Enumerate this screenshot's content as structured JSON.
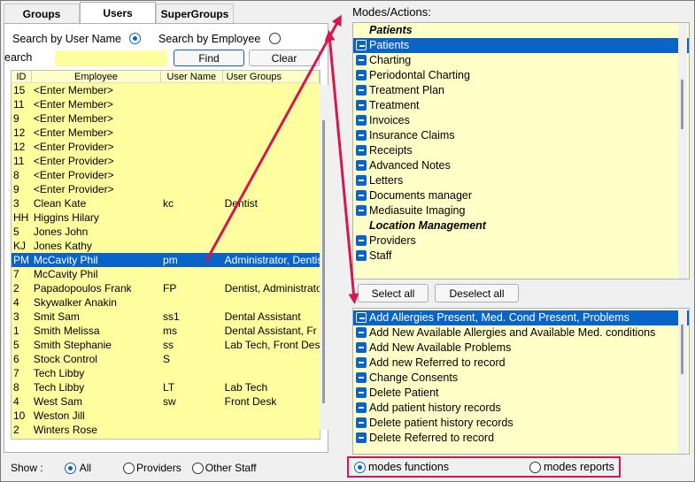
{
  "tabs": [
    "Groups",
    "Users",
    "SuperGroups"
  ],
  "search": {
    "by_user_name": "Search by User Name",
    "by_employee": "Search by Employee",
    "label": "earch",
    "value": "",
    "find": "Find",
    "clear": "Clear"
  },
  "grid": {
    "headers": [
      "ID",
      "Employee",
      "User Name",
      "User Groups"
    ],
    "rows": [
      {
        "id": "15",
        "employee": "<Enter Member>",
        "user": "",
        "groups": ""
      },
      {
        "id": "11",
        "employee": "<Enter Member>",
        "user": "",
        "groups": ""
      },
      {
        "id": "9",
        "employee": "<Enter Member>",
        "user": "",
        "groups": ""
      },
      {
        "id": "12",
        "employee": "<Enter Member>",
        "user": "",
        "groups": ""
      },
      {
        "id": "12",
        "employee": "<Enter Provider>",
        "user": "",
        "groups": ""
      },
      {
        "id": "11",
        "employee": "<Enter Provider>",
        "user": "",
        "groups": ""
      },
      {
        "id": "8",
        "employee": "<Enter Provider>",
        "user": "",
        "groups": ""
      },
      {
        "id": "9",
        "employee": "<Enter Provider>",
        "user": "",
        "groups": ""
      },
      {
        "id": "3",
        "employee": "Clean Kate",
        "user": "kc",
        "groups": "Dentist"
      },
      {
        "id": "HH",
        "employee": "Higgins Hilary",
        "user": "",
        "groups": ""
      },
      {
        "id": "5",
        "employee": "Jones John",
        "user": "",
        "groups": ""
      },
      {
        "id": "KJ",
        "employee": "Jones Kathy",
        "user": "",
        "groups": ""
      },
      {
        "id": "PM",
        "employee": "McCavity Phil",
        "user": "pm",
        "groups": "Administrator, Dentist"
      },
      {
        "id": "7",
        "employee": "McCavity Phil",
        "user": "",
        "groups": ""
      },
      {
        "id": "2",
        "employee": "Papadopoulos Frank",
        "user": "FP",
        "groups": "Dentist, Administrator"
      },
      {
        "id": "4",
        "employee": "Skywalker Anakin",
        "user": "",
        "groups": ""
      },
      {
        "id": "3",
        "employee": "Smit Sam",
        "user": "ss1",
        "groups": "Dental Assistant"
      },
      {
        "id": "1",
        "employee": "Smith Melissa",
        "user": "ms",
        "groups": "Dental Assistant, Fr"
      },
      {
        "id": "5",
        "employee": "Smith Stephanie",
        "user": "ss",
        "groups": "Lab Tech, Front Des"
      },
      {
        "id": "6",
        "employee": "Stock  Control",
        "user": "S",
        "groups": ""
      },
      {
        "id": "7",
        "employee": "Tech Libby",
        "user": "",
        "groups": ""
      },
      {
        "id": "8",
        "employee": "Tech Libby",
        "user": "LT",
        "groups": "Lab Tech"
      },
      {
        "id": "4",
        "employee": "West Sam",
        "user": "sw",
        "groups": "Front Desk"
      },
      {
        "id": "10",
        "employee": "Weston Jill",
        "user": "",
        "groups": ""
      },
      {
        "id": "2",
        "employee": "Winters Rose",
        "user": "",
        "groups": ""
      }
    ],
    "selected_index": 12
  },
  "show": {
    "label": "Show :",
    "all": "All",
    "providers": "Providers",
    "other": "Other Staff"
  },
  "modes": {
    "label": "Modes/Actions:",
    "items": [
      {
        "text": "Patients",
        "cat": true
      },
      {
        "text": "Patients",
        "sel": true
      },
      {
        "text": "Charting"
      },
      {
        "text": "Periodontal Charting"
      },
      {
        "text": "Treatment Plan"
      },
      {
        "text": "Treatment"
      },
      {
        "text": "Invoices"
      },
      {
        "text": "Insurance Claims"
      },
      {
        "text": "Receipts"
      },
      {
        "text": "Advanced Notes"
      },
      {
        "text": "Letters"
      },
      {
        "text": "Documents manager"
      },
      {
        "text": "Mediasuite Imaging"
      },
      {
        "text": "Location Management",
        "cat": true
      },
      {
        "text": "Providers"
      },
      {
        "text": "Staff"
      }
    ]
  },
  "select_all": "Select all",
  "deselect_all": "Deselect all",
  "functions": {
    "items": [
      {
        "text": "Add Allergies Present, Med. Cond Present, Problems",
        "sel": true
      },
      {
        "text": "Add New Available Allergies and Available Med. conditions"
      },
      {
        "text": "Add New Available Problems"
      },
      {
        "text": "Add new Referred to record"
      },
      {
        "text": "Change Consents"
      },
      {
        "text": "Delete Patient"
      },
      {
        "text": "Add patient history records"
      },
      {
        "text": "Delete patient history records"
      },
      {
        "text": "Delete Referred to record"
      }
    ]
  },
  "bottom": {
    "functions": "modes functions",
    "reports": "modes reports"
  },
  "colors": {
    "accent": "#0a64c8",
    "highlight": "#d5174e",
    "grid_bg": "#ffffa0"
  }
}
